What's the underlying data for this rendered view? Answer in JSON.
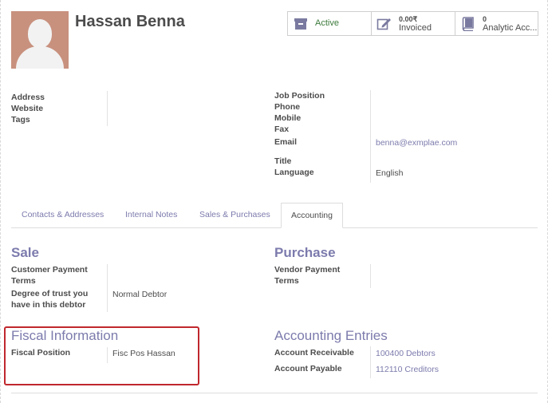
{
  "partner": {
    "name": "Hassan Benna"
  },
  "smart_buttons": [
    {
      "label": "Active",
      "value": "",
      "icon": "archive-icon"
    },
    {
      "label": "Invoiced",
      "value": "0.00₹",
      "icon": "pencil-square-icon"
    },
    {
      "label": "Analytic Acc...",
      "value": "0",
      "icon": "book-icon"
    }
  ],
  "left_fields": {
    "address": "Address",
    "website": "Website",
    "tags": "Tags"
  },
  "right_fields": {
    "job_position": "Job Position",
    "phone": "Phone",
    "mobile": "Mobile",
    "fax": "Fax",
    "email": "Email",
    "email_value": "benna@exmplae.com",
    "title": "Title",
    "language": "Language",
    "language_value": "English"
  },
  "tabs": [
    {
      "label": "Contacts & Addresses"
    },
    {
      "label": "Internal Notes"
    },
    {
      "label": "Sales & Purchases"
    },
    {
      "label": "Accounting"
    }
  ],
  "sale": {
    "title": "Sale",
    "payment_terms_line1": "Customer Payment",
    "payment_terms_line2": "Terms",
    "trust_line1": "Degree of trust you",
    "trust_line2": "have in this debtor",
    "trust_value": "Normal Debtor"
  },
  "purchase": {
    "title": "Purchase",
    "payment_terms_line1": "Vendor Payment",
    "payment_terms_line2": "Terms"
  },
  "fiscal": {
    "title": "Fiscal Information",
    "position_label": "Fiscal Position",
    "position_value": "Fisc Pos Hassan"
  },
  "accounting_entries": {
    "title": "Accounting Entries",
    "receivable_label": "Account Receivable",
    "receivable_value": "100400 Debtors",
    "payable_label": "Account Payable",
    "payable_value": "112110 Creditors"
  },
  "colors": {
    "accent": "#7c7bad",
    "active_green": "#3c7a3c",
    "highlight_red": "#c0272d",
    "avatar_bg": "#c8917e"
  }
}
